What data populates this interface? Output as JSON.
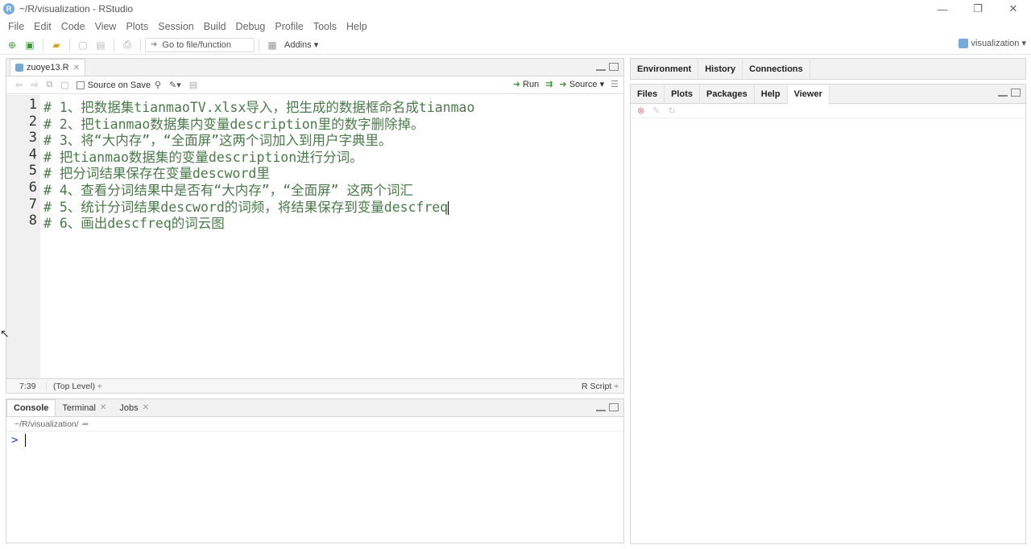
{
  "window": {
    "title": "~/R/visualization - RStudio",
    "app_badge": "R",
    "controls": [
      "—",
      "❐",
      "✕"
    ]
  },
  "menu": [
    "File",
    "Edit",
    "Code",
    "View",
    "Plots",
    "Session",
    "Build",
    "Debug",
    "Profile",
    "Tools",
    "Help"
  ],
  "toolbar": {
    "goto_placeholder": "Go to file/function",
    "addins_label": "Addins ▾",
    "project_label": "visualization ▾"
  },
  "editor": {
    "tab_label": "zuoye13.R",
    "source_on_save": "Source on Save",
    "run_label": "Run",
    "source_label": "Source ▾",
    "line_numbers": [
      "1",
      "2",
      "3",
      "4",
      "5",
      "6",
      "7",
      "8"
    ],
    "lines": [
      "# 1、把数据集tianmaoTV.xlsx导入，把生成的数据框命名成tianmao",
      "# 2、把tianmao数据集内变量description里的数字删除掉。",
      "# 3、将“大内存”，“全面屏”这两个词加入到用户字典里。",
      "# 把tianmao数据集的变量description进行分词。",
      "# 把分词结果保存在变量descword里",
      "# 4、查看分词结果中是否有“大内存”，“全面屏” 这两个词汇",
      "# 5、统计分词结果descword的词频，将结果保存到变量descfreq",
      "# 6、画出descfreq的词云图"
    ],
    "status": {
      "position": "7:39",
      "level": "(Top Level) ÷",
      "file_type": "R Script ÷"
    }
  },
  "console": {
    "tabs": [
      {
        "label": "Console"
      },
      {
        "label": "Terminal"
      },
      {
        "label": "Jobs"
      }
    ],
    "path": "~/R/visualization/",
    "prompt": ">"
  },
  "env_pane": {
    "tabs": [
      "Environment",
      "History",
      "Connections"
    ]
  },
  "viewer_pane": {
    "tabs": [
      "Files",
      "Plots",
      "Packages",
      "Help",
      "Viewer"
    ]
  }
}
